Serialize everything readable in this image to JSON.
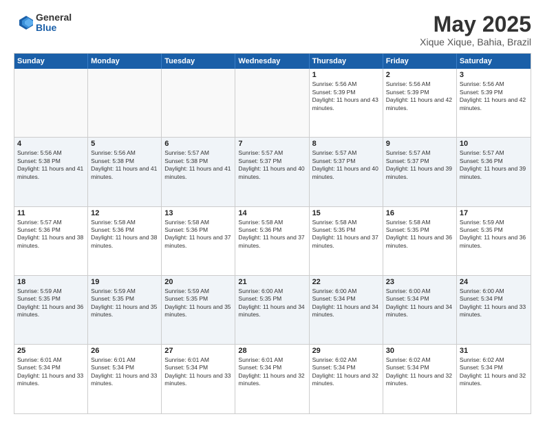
{
  "header": {
    "logo_general": "General",
    "logo_blue": "Blue",
    "title": "May 2025",
    "subtitle": "Xique Xique, Bahia, Brazil"
  },
  "days_of_week": [
    "Sunday",
    "Monday",
    "Tuesday",
    "Wednesday",
    "Thursday",
    "Friday",
    "Saturday"
  ],
  "weeks": [
    [
      {
        "day": "",
        "info": ""
      },
      {
        "day": "",
        "info": ""
      },
      {
        "day": "",
        "info": ""
      },
      {
        "day": "",
        "info": ""
      },
      {
        "day": "1",
        "info": "Sunrise: 5:56 AM\nSunset: 5:39 PM\nDaylight: 11 hours and 43 minutes."
      },
      {
        "day": "2",
        "info": "Sunrise: 5:56 AM\nSunset: 5:39 PM\nDaylight: 11 hours and 42 minutes."
      },
      {
        "day": "3",
        "info": "Sunrise: 5:56 AM\nSunset: 5:39 PM\nDaylight: 11 hours and 42 minutes."
      }
    ],
    [
      {
        "day": "4",
        "info": "Sunrise: 5:56 AM\nSunset: 5:38 PM\nDaylight: 11 hours and 41 minutes."
      },
      {
        "day": "5",
        "info": "Sunrise: 5:56 AM\nSunset: 5:38 PM\nDaylight: 11 hours and 41 minutes."
      },
      {
        "day": "6",
        "info": "Sunrise: 5:57 AM\nSunset: 5:38 PM\nDaylight: 11 hours and 41 minutes."
      },
      {
        "day": "7",
        "info": "Sunrise: 5:57 AM\nSunset: 5:37 PM\nDaylight: 11 hours and 40 minutes."
      },
      {
        "day": "8",
        "info": "Sunrise: 5:57 AM\nSunset: 5:37 PM\nDaylight: 11 hours and 40 minutes."
      },
      {
        "day": "9",
        "info": "Sunrise: 5:57 AM\nSunset: 5:37 PM\nDaylight: 11 hours and 39 minutes."
      },
      {
        "day": "10",
        "info": "Sunrise: 5:57 AM\nSunset: 5:36 PM\nDaylight: 11 hours and 39 minutes."
      }
    ],
    [
      {
        "day": "11",
        "info": "Sunrise: 5:57 AM\nSunset: 5:36 PM\nDaylight: 11 hours and 38 minutes."
      },
      {
        "day": "12",
        "info": "Sunrise: 5:58 AM\nSunset: 5:36 PM\nDaylight: 11 hours and 38 minutes."
      },
      {
        "day": "13",
        "info": "Sunrise: 5:58 AM\nSunset: 5:36 PM\nDaylight: 11 hours and 37 minutes."
      },
      {
        "day": "14",
        "info": "Sunrise: 5:58 AM\nSunset: 5:36 PM\nDaylight: 11 hours and 37 minutes."
      },
      {
        "day": "15",
        "info": "Sunrise: 5:58 AM\nSunset: 5:35 PM\nDaylight: 11 hours and 37 minutes."
      },
      {
        "day": "16",
        "info": "Sunrise: 5:58 AM\nSunset: 5:35 PM\nDaylight: 11 hours and 36 minutes."
      },
      {
        "day": "17",
        "info": "Sunrise: 5:59 AM\nSunset: 5:35 PM\nDaylight: 11 hours and 36 minutes."
      }
    ],
    [
      {
        "day": "18",
        "info": "Sunrise: 5:59 AM\nSunset: 5:35 PM\nDaylight: 11 hours and 36 minutes."
      },
      {
        "day": "19",
        "info": "Sunrise: 5:59 AM\nSunset: 5:35 PM\nDaylight: 11 hours and 35 minutes."
      },
      {
        "day": "20",
        "info": "Sunrise: 5:59 AM\nSunset: 5:35 PM\nDaylight: 11 hours and 35 minutes."
      },
      {
        "day": "21",
        "info": "Sunrise: 6:00 AM\nSunset: 5:35 PM\nDaylight: 11 hours and 34 minutes."
      },
      {
        "day": "22",
        "info": "Sunrise: 6:00 AM\nSunset: 5:34 PM\nDaylight: 11 hours and 34 minutes."
      },
      {
        "day": "23",
        "info": "Sunrise: 6:00 AM\nSunset: 5:34 PM\nDaylight: 11 hours and 34 minutes."
      },
      {
        "day": "24",
        "info": "Sunrise: 6:00 AM\nSunset: 5:34 PM\nDaylight: 11 hours and 33 minutes."
      }
    ],
    [
      {
        "day": "25",
        "info": "Sunrise: 6:01 AM\nSunset: 5:34 PM\nDaylight: 11 hours and 33 minutes."
      },
      {
        "day": "26",
        "info": "Sunrise: 6:01 AM\nSunset: 5:34 PM\nDaylight: 11 hours and 33 minutes."
      },
      {
        "day": "27",
        "info": "Sunrise: 6:01 AM\nSunset: 5:34 PM\nDaylight: 11 hours and 33 minutes."
      },
      {
        "day": "28",
        "info": "Sunrise: 6:01 AM\nSunset: 5:34 PM\nDaylight: 11 hours and 32 minutes."
      },
      {
        "day": "29",
        "info": "Sunrise: 6:02 AM\nSunset: 5:34 PM\nDaylight: 11 hours and 32 minutes."
      },
      {
        "day": "30",
        "info": "Sunrise: 6:02 AM\nSunset: 5:34 PM\nDaylight: 11 hours and 32 minutes."
      },
      {
        "day": "31",
        "info": "Sunrise: 6:02 AM\nSunset: 5:34 PM\nDaylight: 11 hours and 32 minutes."
      }
    ]
  ]
}
